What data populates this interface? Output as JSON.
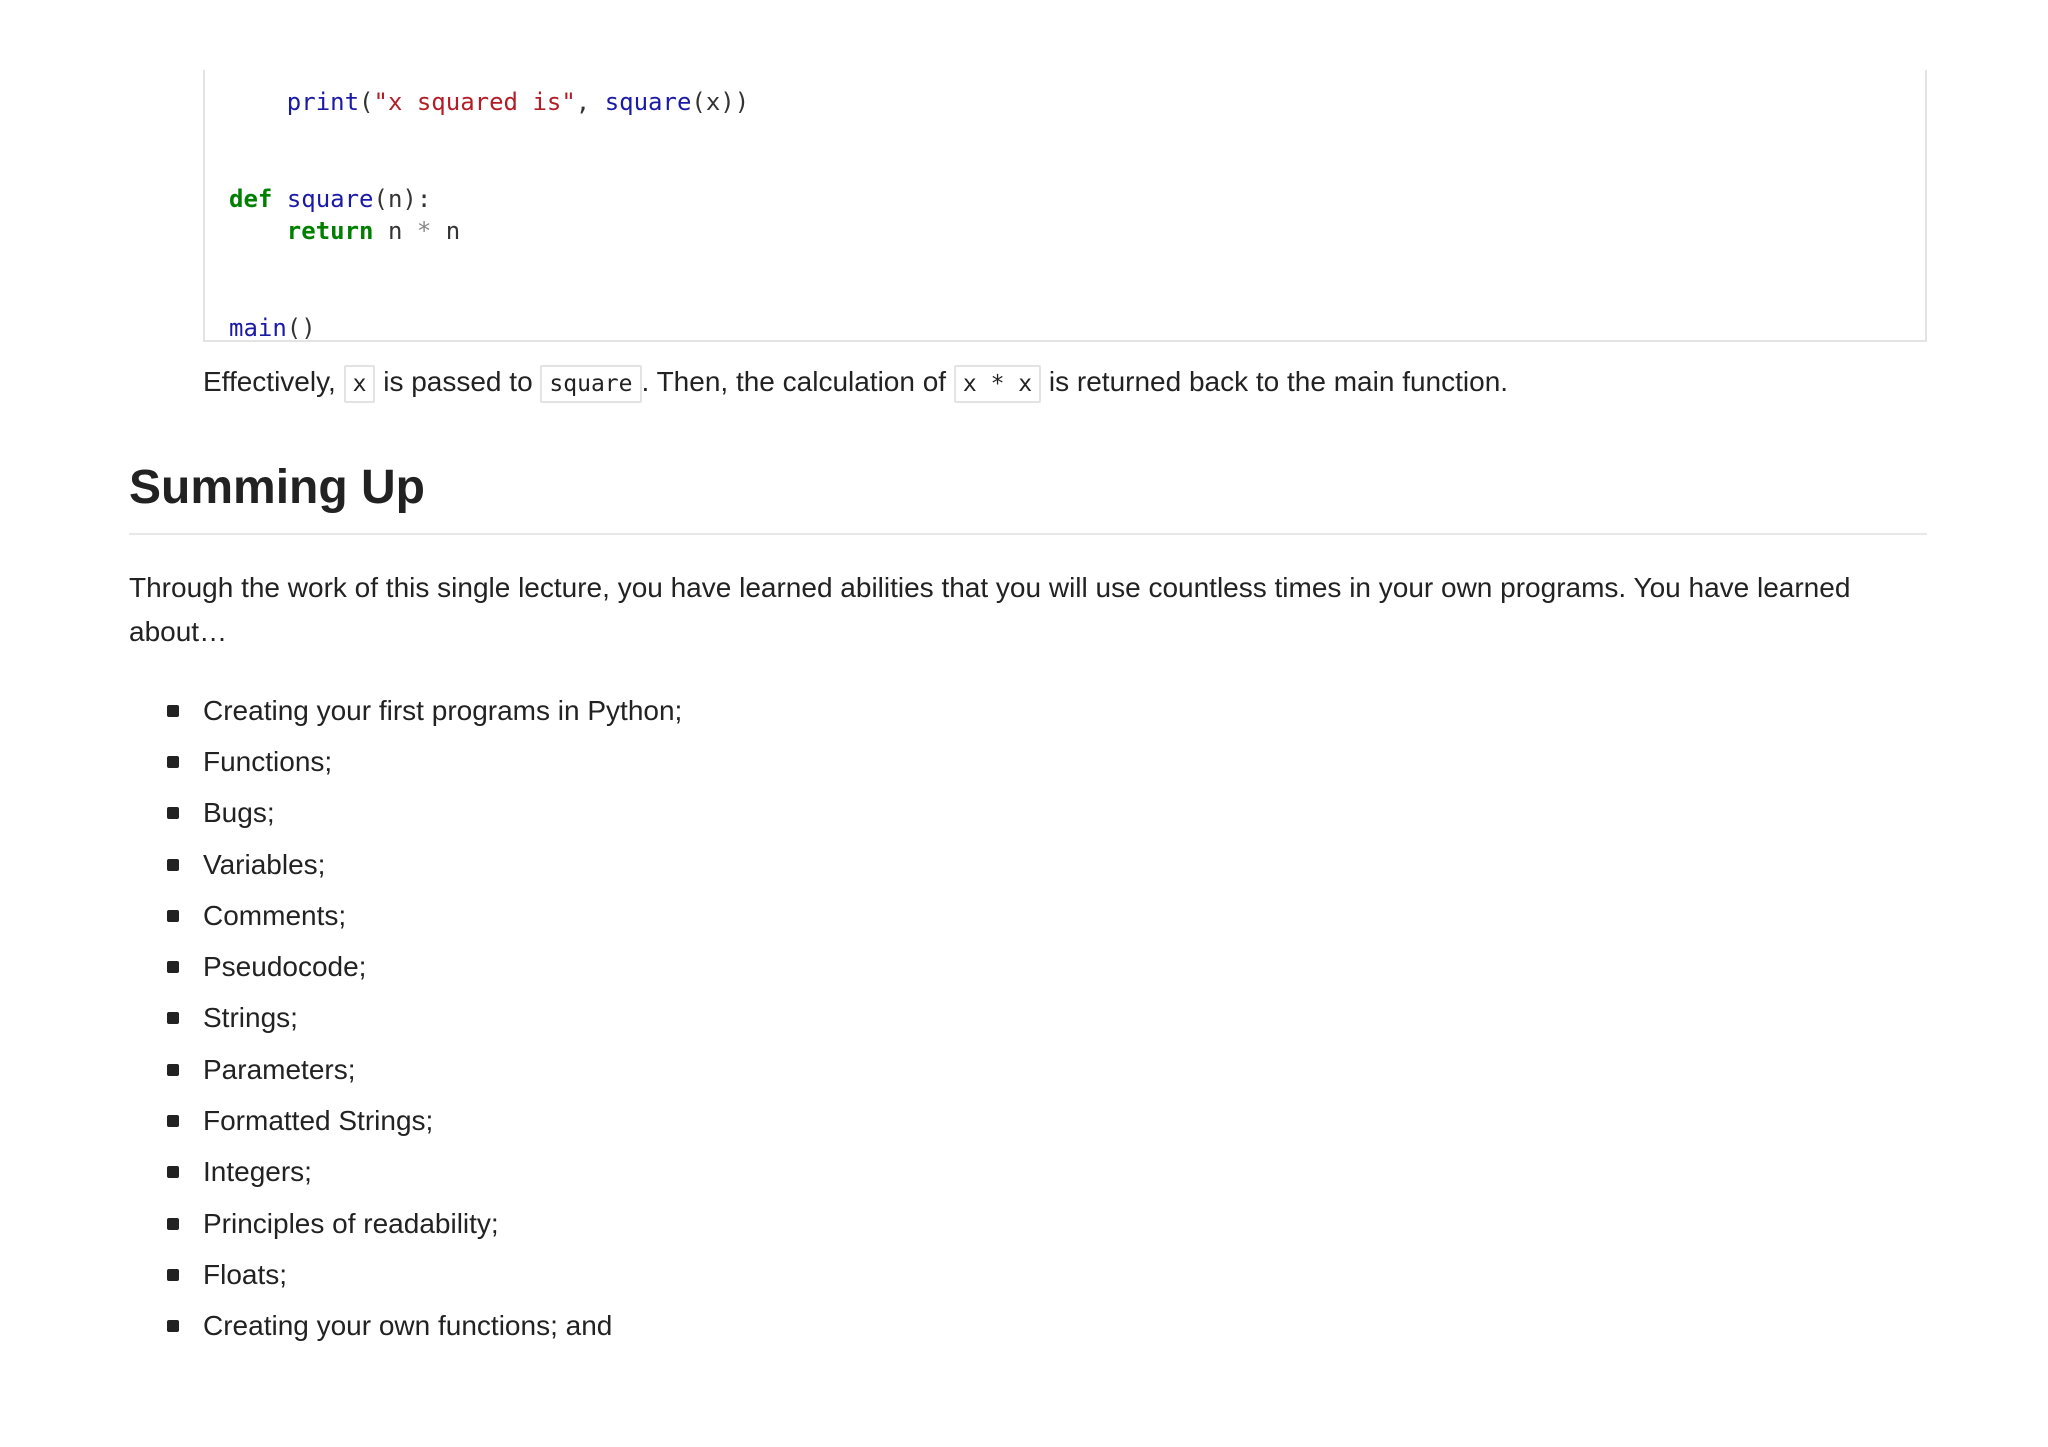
{
  "code": {
    "line1": {
      "indent": "    ",
      "fn": "print",
      "open": "(",
      "string": "\"x squared is\"",
      "comma": ", ",
      "call": "square",
      "rest": "(x))"
    },
    "line2": {
      "kw": "def",
      "space": " ",
      "name": "square",
      "rest": "(n):"
    },
    "line3": {
      "indent": "    ",
      "kw": "return",
      "a": " n ",
      "op": "*",
      "b": " n"
    },
    "line4": {
      "fn": "main",
      "rest": "()"
    }
  },
  "explanation": {
    "part1": "Effectively, ",
    "code1": "x",
    "part2": " is passed to ",
    "code2": "square",
    "part3": ". Then, the calculation of ",
    "code3": "x * x",
    "part4": " is returned back to the main function."
  },
  "section": {
    "heading": "Summing Up",
    "intro": "Through the work of this single lecture, you have learned abilities that you will use countless times in your own programs. You have learned about…",
    "items": [
      "Creating your first programs in Python;",
      "Functions;",
      "Bugs;",
      "Variables;",
      "Comments;",
      "Pseudocode;",
      "Strings;",
      "Parameters;",
      "Formatted Strings;",
      "Integers;",
      "Principles of readability;",
      "Floats;",
      "Creating your own functions; and"
    ]
  }
}
